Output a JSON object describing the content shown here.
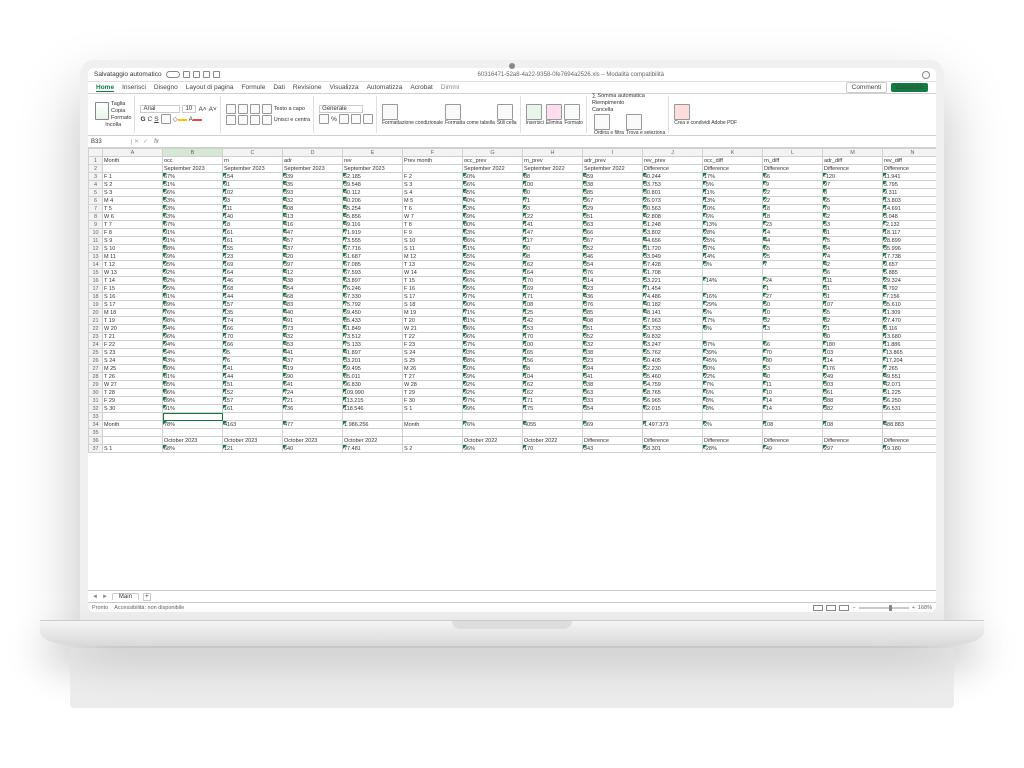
{
  "titlebar": {
    "autosave": "Salvataggio automatico",
    "doc": "60316471-52a8-4a22-9358-0fe7694a2526.xls – Modalità compatibilità"
  },
  "tabs": {
    "items": [
      "Home",
      "Inserisci",
      "Disegno",
      "Layout di pagina",
      "Formule",
      "Dati",
      "Revisione",
      "Visualizza",
      "Automatizza",
      "Acrobat",
      "Dimmi"
    ],
    "comments": "Commenti",
    "share": "Condividi"
  },
  "ribbon": {
    "clipboard": {
      "cut": "Taglia",
      "copy": "Copia",
      "format": "Formato",
      "paste": "Incolla"
    },
    "font": {
      "name": "Arial",
      "size": "10"
    },
    "align": {
      "wrap": "Testo a capo",
      "merge": "Unisci e centra"
    },
    "number": {
      "general": "Generale"
    },
    "styles": {
      "cond": "Formattazione condizionale",
      "table": "Formatta come tabella",
      "cell": "Stili cella"
    },
    "cells": {
      "insert": "Inserisci",
      "delete": "Elimina",
      "format": "Formato"
    },
    "editing": {
      "sum": "Somma automatica",
      "fill": "Riempimento",
      "clear": "Cancella",
      "sort": "Ordina e filtra",
      "find": "Trova e seleziona"
    },
    "pdf": {
      "label": "Crea e condividi Adobe PDF"
    }
  },
  "fx": {
    "cell": "B33",
    "formula": ""
  },
  "sheet": {
    "name": "Main"
  },
  "status": {
    "ready": "Pronto",
    "access": "Accessibilità: non disponibile",
    "zoom": "168%"
  },
  "cols": [
    "A",
    "B",
    "C",
    "D",
    "E",
    "F",
    "G",
    "H",
    "I",
    "J",
    "K",
    "L",
    "M",
    "N"
  ],
  "chart_data": {
    "type": "table",
    "headers": [
      "Month",
      "occ",
      "rn",
      "adr",
      "rev",
      "Prev month",
      "occ_prev",
      "rn_prev",
      "adr_prev",
      "rev_prev",
      "occ_diff",
      "rn_diff",
      "adr_diff",
      "rev_diff"
    ],
    "subheaders": [
      "",
      "September 2023",
      "September 2023",
      "September 2023",
      "September 2023",
      "",
      "September 2022",
      "September 2022",
      "September 2022",
      "Difference",
      "Difference",
      "Difference",
      "Difference",
      "Difference"
    ],
    "rows": [
      [
        "F 1",
        "67%",
        "154",
        "339",
        "52.185",
        "F 2",
        "50%",
        "88",
        "459",
        "40.244",
        "17%",
        "66",
        "-120",
        "11.941"
      ],
      [
        "S 2",
        "51%",
        "91",
        "435",
        "39.548",
        "S 3",
        "56%",
        "100",
        "338",
        "33.753",
        "-5%",
        "-9",
        "97",
        "5.795"
      ],
      [
        "S 3",
        "56%",
        "102",
        "393",
        "40.112",
        "S 4",
        "45%",
        "80",
        "385",
        "30.801",
        "11%",
        "22",
        "8",
        "9.311"
      ],
      [
        "M 4",
        "53%",
        "93",
        "432",
        "40.206",
        "M 5",
        "40%",
        "71",
        "367",
        "26.073",
        "13%",
        "22",
        "65",
        "13.803"
      ],
      [
        "T 5",
        "63%",
        "111",
        "408",
        "45.254",
        "T 6",
        "53%",
        "93",
        "329",
        "30.563",
        "10%",
        "18",
        "79",
        "14.691"
      ],
      [
        "W 6",
        "63%",
        "140",
        "413",
        "45.856",
        "W 7",
        "69%",
        "122",
        "351",
        "42.808",
        "-6%",
        "18",
        "62",
        "3.048"
      ],
      [
        "T 7",
        "67%",
        "18",
        "416",
        "49.116",
        "T 8",
        "80%",
        "141",
        "363",
        "51.248",
        "-13%",
        "-23",
        "53",
        "-2.132"
      ],
      [
        "F 8",
        "91%",
        "161",
        "447",
        "71.919",
        "F 9",
        "63%",
        "147",
        "366",
        "53.802",
        "28%",
        "14",
        "81",
        "18.117"
      ],
      [
        "S 9",
        "91%",
        "161",
        "457",
        "73.555",
        "S 10",
        "86%",
        "117",
        "367",
        "44.656",
        "25%",
        "44",
        "75",
        "28.899"
      ],
      [
        "S 10",
        "88%",
        "155",
        "437",
        "67.716",
        "S 11",
        "51%",
        "90",
        "352",
        "31.720",
        "37%",
        "65",
        "84",
        "35.996"
      ],
      [
        "M 11",
        "69%",
        "123",
        "420",
        "51.687",
        "M 12",
        "55%",
        "98",
        "346",
        "33.949",
        "14%",
        "25",
        "74",
        "17.738"
      ],
      [
        "T 12",
        "95%",
        "169",
        "397",
        "67.085",
        "T 13",
        "92%",
        "162",
        "354",
        "57.428",
        "3%",
        "7",
        "42",
        "9.657"
      ],
      [
        "W 13",
        "92%",
        "164",
        "412",
        "67.593",
        "W 14",
        "93%",
        "164",
        "376",
        "61.708",
        "",
        "",
        "36",
        "5.885"
      ],
      [
        "T 14",
        "82%",
        "146",
        "438",
        "63.897",
        "T 15",
        "96%",
        "170",
        "314",
        "53.221",
        "-14%",
        "-24",
        "111",
        "29.324"
      ],
      [
        "F 15",
        "95%",
        "168",
        "454",
        "76.246",
        "F 16",
        "95%",
        "169",
        "423",
        "71.454",
        "",
        "-1",
        "31",
        "4.792"
      ],
      [
        "S 16",
        "81%",
        "144",
        "468",
        "67.330",
        "S 17",
        "97%",
        "171",
        "436",
        "74.486",
        "-16%",
        "-27",
        "31",
        "-7.156"
      ],
      [
        "S 17",
        "89%",
        "157",
        "483",
        "75.792",
        "S 18",
        "90%",
        "108",
        "376",
        "40.182",
        "-29%",
        "50",
        "107",
        "35.610"
      ],
      [
        "M 18",
        "76%",
        "135",
        "440",
        "59.450",
        "M 19",
        "71%",
        "125",
        "385",
        "48.141",
        "5%",
        "10",
        "55",
        "11.309"
      ],
      [
        "T 19",
        "98%",
        "174",
        "491",
        "85.433",
        "T 20",
        "81%",
        "142",
        "408",
        "57.963",
        "17%",
        "32",
        "82",
        "27.470"
      ],
      [
        "W 20",
        "94%",
        "166",
        "373",
        "61.849",
        "W 21",
        "86%",
        "153",
        "351",
        "53.733",
        "8%",
        "13",
        "21",
        "8.116"
      ],
      [
        "T 21",
        "96%",
        "170",
        "432",
        "73.512",
        "T 22",
        "96%",
        "170",
        "352",
        "59.832",
        "",
        "",
        "80",
        "13.680"
      ],
      [
        "F 22",
        "94%",
        "166",
        "453",
        "75.133",
        "F 23",
        "57%",
        "100",
        "632",
        "63.247",
        "37%",
        "66",
        "-180",
        "11.886"
      ],
      [
        "S 23",
        "54%",
        "95",
        "441",
        "41.897",
        "S 24",
        "93%",
        "165",
        "338",
        "55.762",
        "-39%",
        "-70",
        "103",
        "-13.865"
      ],
      [
        "S 24",
        "43%",
        "76",
        "437",
        "33.201",
        "S 25",
        "88%",
        "156",
        "323",
        "50.405",
        "-45%",
        "-80",
        "114",
        "-17.204"
      ],
      [
        "M 25",
        "80%",
        "141",
        "419",
        "59.495",
        "M 26",
        "50%",
        "88",
        "594",
        "52.230",
        "30%",
        "53",
        "-176",
        "7.265"
      ],
      [
        "T 26",
        "81%",
        "144",
        "590",
        "85.011",
        "T 27",
        "59%",
        "104",
        "341",
        "35.460",
        "22%",
        "40",
        "249",
        "49.551"
      ],
      [
        "W 27",
        "85%",
        "151",
        "641",
        "96.830",
        "W 28",
        "92%",
        "162",
        "338",
        "54.759",
        "-7%",
        "-11",
        "303",
        "42.071"
      ],
      [
        "T 28",
        "86%",
        "152",
        "724",
        "109.990",
        "T 29",
        "92%",
        "162",
        "363",
        "58.765",
        "-6%",
        "-10",
        "361",
        "51.225"
      ],
      [
        "F 29",
        "89%",
        "157",
        "721",
        "113.215",
        "F 30",
        "97%",
        "171",
        "333",
        "56.965",
        "-8%",
        "-14",
        "388",
        "56.250"
      ],
      [
        "S 30",
        "91%",
        "161",
        "736",
        "118.546",
        "S 1",
        "99%",
        "175",
        "354",
        "62.015",
        "-8%",
        "-14",
        "382",
        "56.531"
      ],
      [
        "",
        "",
        "",
        "",
        "",
        "",
        "",
        "",
        "",
        "",
        "",
        "",
        "",
        ""
      ],
      [
        "Month",
        "78%",
        "4163",
        "477",
        "1.986.256",
        "Month",
        "76%",
        "4055",
        "369",
        "1.497.373",
        "2%",
        "108",
        "108",
        "488.883"
      ],
      [
        "",
        "",
        "",
        "",
        "",
        "",
        "",
        "",
        "",
        "",
        "",
        "",
        "",
        ""
      ],
      [
        "",
        "October 2023",
        "October 2023",
        "October 2023",
        "October 2022",
        "",
        "October 2022",
        "October 2022",
        "Difference",
        "Difference",
        "Difference",
        "Difference",
        "Difference",
        "Difference"
      ],
      [
        "S 1",
        "68%",
        "121",
        "640",
        "77.481",
        "S 2",
        "96%",
        "170",
        "343",
        "58.301",
        "-28%",
        "-49",
        "297",
        "19.180"
      ]
    ]
  }
}
